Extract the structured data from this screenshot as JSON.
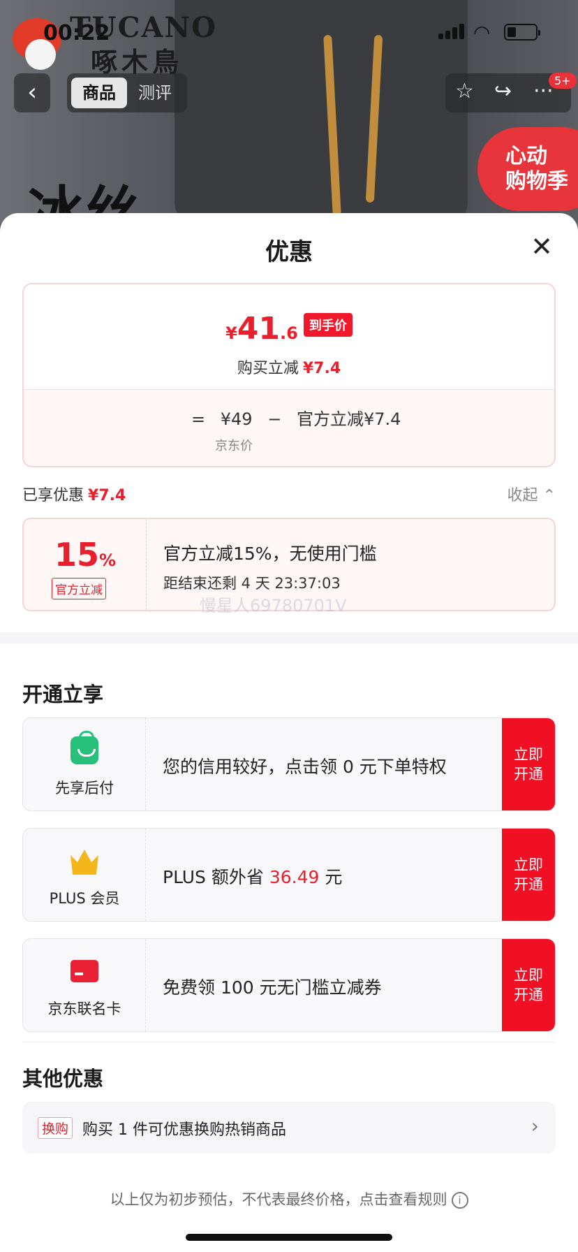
{
  "status": {
    "time": "00:22"
  },
  "logo": {
    "brand_en": "TUCANO",
    "brand_cn": "啄木鳥"
  },
  "nav": {
    "tabs": [
      "商品",
      "测评"
    ],
    "badge": "5+"
  },
  "promo": {
    "text1": "心动",
    "text2": "购物季"
  },
  "product_big_text": "冰丝",
  "sheet": {
    "title": "优惠",
    "price": {
      "currency": "¥",
      "integer": "41",
      "decimal": ".6",
      "tag": "到手价",
      "save_label": "购买立减",
      "save_value": "¥7.4",
      "equation_eq": "=",
      "jd_price": "¥49",
      "minus": "−",
      "official_cut": "官方立减¥7.4",
      "jd_price_label": "京东价"
    },
    "enjoyed": {
      "label": "已享优惠",
      "value": "¥7.4",
      "collapse": "收起"
    },
    "coupon": {
      "pct": "15",
      "pct_sym": "%",
      "tag": "官方立减",
      "title": "官方立减15%，无使用门槛",
      "timer": "距结束还剩 4 天 23:37:03"
    },
    "watermark": "慢星人69780701V",
    "open_section": {
      "title": "开通立享",
      "items": [
        {
          "label": "先享后付",
          "text": "您的信用较好，点击领 0 元下单特权",
          "button": [
            "立即",
            "开通"
          ],
          "icon": "shopping-bag-icon"
        },
        {
          "label": "PLUS 会员",
          "text_pre": "PLUS 额外省 ",
          "text_highlight": "36.49",
          "text_post": " 元",
          "button": [
            "立即",
            "开通"
          ],
          "icon": "crown-icon"
        },
        {
          "label": "京东联名卡",
          "text": "免费领 100 元无门槛立减券",
          "button": [
            "立即",
            "开通"
          ],
          "icon": "bank-card-icon"
        }
      ]
    },
    "other": {
      "title": "其他优惠",
      "tag": "换购",
      "text": "购买 1 件可优惠换购热销商品"
    },
    "disclaimer": "以上仅为初步预估，不代表最终价格，点击查看规则"
  },
  "colors": {
    "accent_red": "#f10f24",
    "price_red": "#e8202e",
    "green": "#27c07a",
    "gold": "#f5b619"
  }
}
